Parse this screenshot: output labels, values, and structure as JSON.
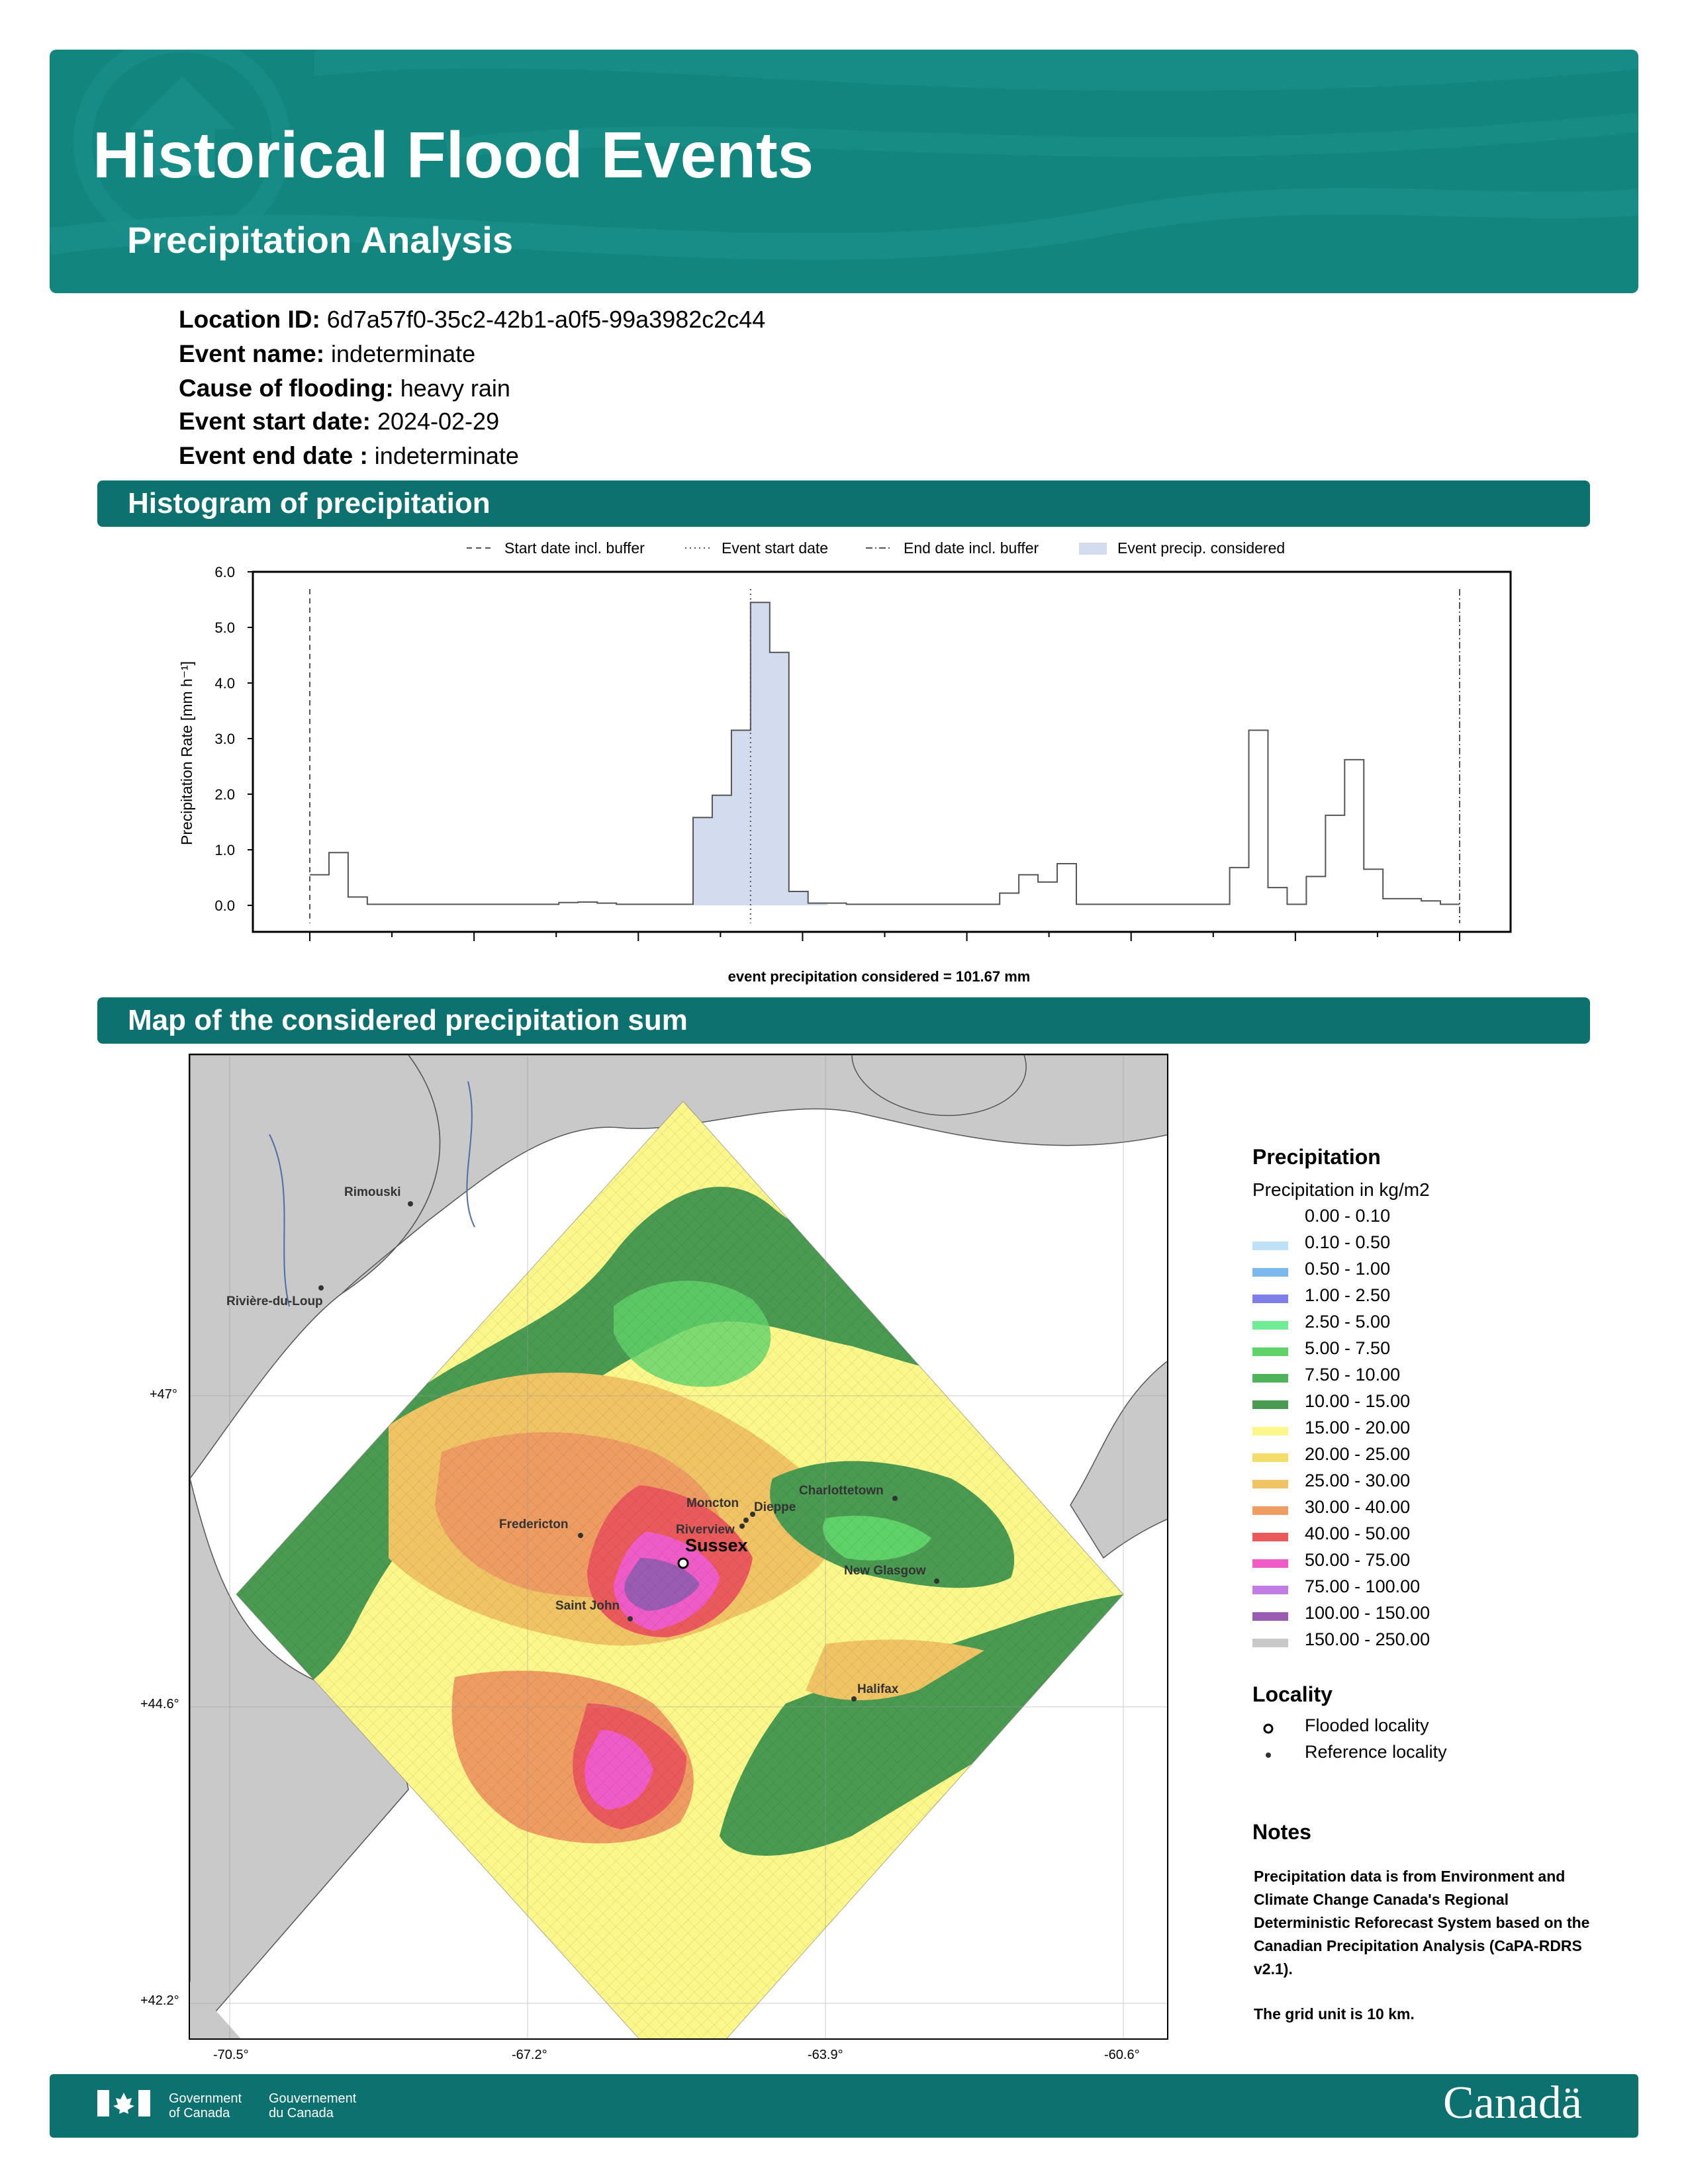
{
  "header": {
    "title": "Historical Flood Events",
    "subtitle": "Precipitation Analysis"
  },
  "info": [
    {
      "label": "Location ID:",
      "value": "6d7a57f0-35c2-42b1-a0f5-99a3982c2c44"
    },
    {
      "label": "Event name:",
      "value": "indeterminate"
    },
    {
      "label": "Cause of flooding:",
      "value": "heavy rain"
    },
    {
      "label": "Event start date:",
      "value": "2024-02-29"
    },
    {
      "label": "Event end date :",
      "value": "indeterminate"
    }
  ],
  "sections": {
    "histogram": "Histogram of precipitation",
    "map": "Map of the considered precipitation sum"
  },
  "chart_data": {
    "type": "bar",
    "ylabel": "Precipitation Rate [mm h⁻¹]",
    "ylim": [
      0,
      6
    ],
    "y_ticks": [
      "0.0",
      "1.0",
      "2.0",
      "3.0",
      "4.0",
      "5.0",
      "6.0"
    ],
    "legend": [
      "Start date incl. buffer",
      "Event start date",
      "End date incl. buffer",
      "Event precip. considered"
    ],
    "legend_position": "top",
    "step_values": [
      0.55,
      0.95,
      0.15,
      0.02,
      0.02,
      0.02,
      0.02,
      0.02,
      0.02,
      0.02,
      0.02,
      0.02,
      0.02,
      0.05,
      0.06,
      0.04,
      0.02,
      0.02,
      0.02,
      0.02,
      1.58,
      1.98,
      3.15,
      5.45,
      4.55,
      0.25,
      0.04,
      0.04,
      0.02,
      0.02,
      0.02,
      0.02,
      0.02,
      0.02,
      0.02,
      0.02,
      0.22,
      0.55,
      0.42,
      0.75,
      0.02,
      0.02,
      0.02,
      0.02,
      0.02,
      0.02,
      0.02,
      0.02,
      0.68,
      3.15,
      0.32,
      0.02,
      0.52,
      1.62,
      2.62,
      0.65,
      0.12,
      0.12,
      0.08,
      0.02
    ],
    "start_buffer_index": 0,
    "event_start_index": 23,
    "end_buffer_index": 60,
    "event_range": [
      20,
      27
    ],
    "caption": "event precipitation considered = 101.67 mm"
  },
  "map": {
    "lon_ticks": [
      "-70.5°",
      "-67.2°",
      "-63.9°",
      "-60.6°"
    ],
    "lat_ticks": [
      "+47°",
      "+44.6°",
      "+42.2°"
    ],
    "cities": [
      {
        "name": "Rimouski"
      },
      {
        "name": "Rivière-du-Loup"
      },
      {
        "name": "Charlottetown"
      },
      {
        "name": "Moncton"
      },
      {
        "name": "Dieppe"
      },
      {
        "name": "Riverview"
      },
      {
        "name": "Fredericton"
      },
      {
        "name": "New Glasgow"
      },
      {
        "name": "Saint John"
      },
      {
        "name": "Halifax"
      }
    ],
    "flooded": "Sussex"
  },
  "legend": {
    "title": "Precipitation",
    "subtitle": "Precipitation in kg/m2",
    "items": [
      {
        "label": "0.00 - 0.10",
        "color": "#ffffff"
      },
      {
        "label": "0.10 - 0.50",
        "color": "#bfe1f7"
      },
      {
        "label": "0.50 - 1.00",
        "color": "#7ab8ee"
      },
      {
        "label": "1.00 - 2.50",
        "color": "#7f7fe9"
      },
      {
        "label": "2.50 - 5.00",
        "color": "#6fec95"
      },
      {
        "label": "5.00 - 7.50",
        "color": "#5fd36a"
      },
      {
        "label": "7.50 - 10.00",
        "color": "#4fb35a"
      },
      {
        "label": "10.00 - 15.00",
        "color": "#4a9a52"
      },
      {
        "label": "15.00 - 20.00",
        "color": "#fcf78a"
      },
      {
        "label": "20.00 - 25.00",
        "color": "#f4dd6a"
      },
      {
        "label": "25.00 - 30.00",
        "color": "#f0c464"
      },
      {
        "label": "30.00 - 40.00",
        "color": "#ee9c62"
      },
      {
        "label": "40.00 - 50.00",
        "color": "#ea5a5c"
      },
      {
        "label": "50.00 - 75.00",
        "color": "#ef5cc7"
      },
      {
        "label": "75.00 - 100.00",
        "color": "#c27de3"
      },
      {
        "label": "100.00 - 150.00",
        "color": "#9a5cb3"
      },
      {
        "label": "150.00 - 250.00",
        "color": "#c8c8c8"
      }
    ],
    "locality_title": "Locality",
    "flooded_label": "Flooded locality",
    "reference_label": "Reference locality"
  },
  "notes": {
    "title": "Notes",
    "text": "Precipitation data is from Environment and Climate Change Canada's Regional Deterministic Reforecast System based on the Canadian Precipitation Analysis (CaPA-RDRS v2.1).",
    "grid": "The grid unit is 10 km."
  },
  "footer": {
    "gov_en_1": "Government",
    "gov_en_2": "of Canada",
    "gov_fr_1": "Gouvernement",
    "gov_fr_2": "du Canada",
    "wordmark": "Canadä"
  }
}
